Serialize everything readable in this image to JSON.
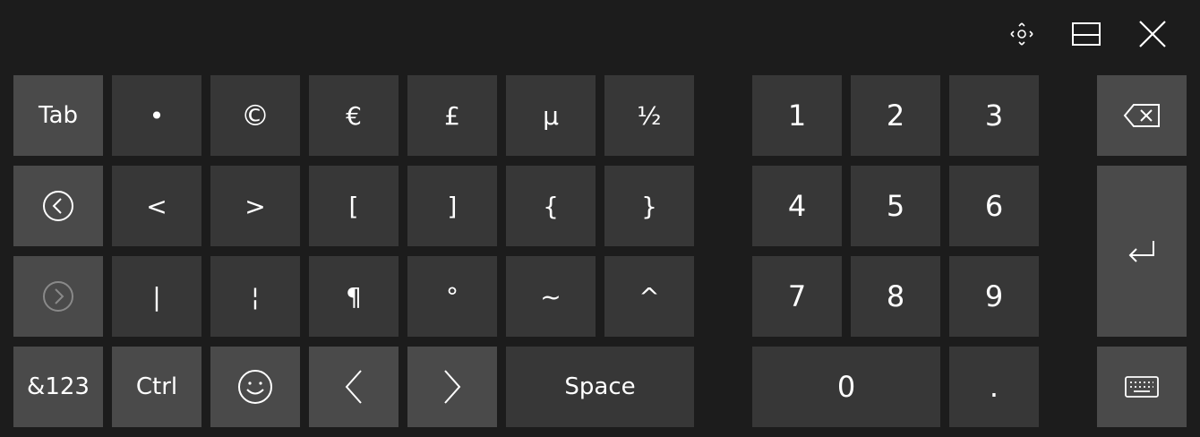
{
  "window_controls": {
    "move_icon": "move-icon",
    "dock_icon": "dock-icon",
    "close_icon": "close-icon"
  },
  "symbols_keys": {
    "row1": [
      "Tab",
      "•",
      "©",
      "€",
      "£",
      "µ",
      "½"
    ],
    "row2": [
      "<",
      ">",
      "[",
      "]",
      "{",
      "}"
    ],
    "row3": [
      "|",
      "¦",
      "¶",
      "°",
      "~",
      "^"
    ],
    "row4": {
      "mode": "&123",
      "ctrl": "Ctrl",
      "space": "Space"
    }
  },
  "number_keys": [
    "1",
    "2",
    "3",
    "4",
    "5",
    "6",
    "7",
    "8",
    "9",
    "0",
    "."
  ],
  "icons": {
    "prev_page": "circle-left-icon",
    "next_page": "circle-right-icon",
    "emoji": "emoji-icon",
    "left_arrow": "chevron-left-icon",
    "right_arrow": "chevron-right-icon",
    "backspace": "backspace-icon",
    "enter": "enter-icon",
    "keyboard": "keyboard-icon"
  },
  "colors": {
    "background": "#1c1c1c",
    "key_symbol": "#373737",
    "key_function": "#4a4a4a",
    "text": "#ffffff"
  }
}
